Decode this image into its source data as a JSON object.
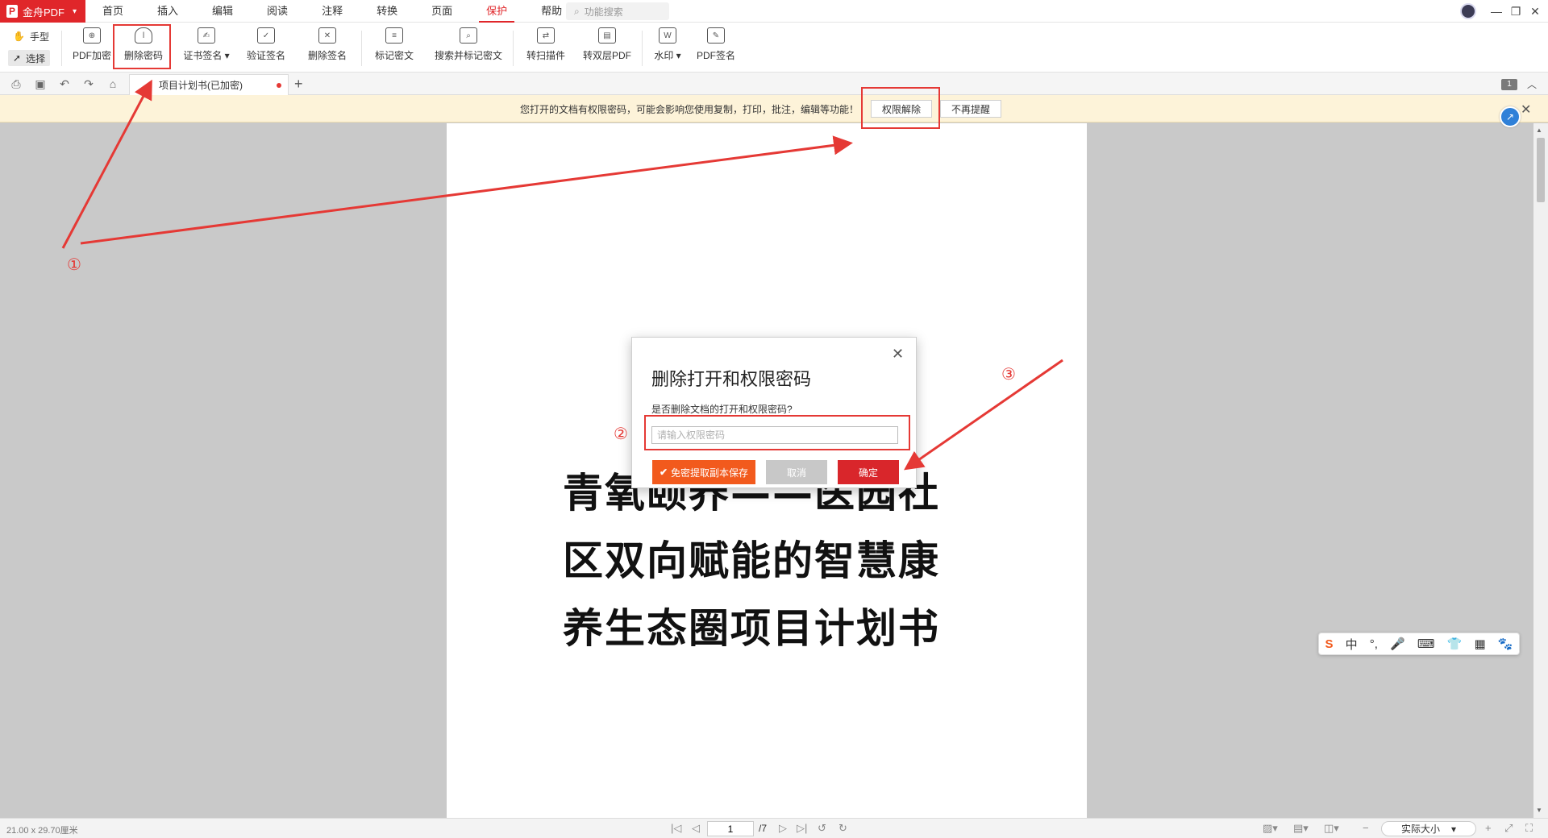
{
  "app": {
    "name": "金舟PDF",
    "logo_glyph": "P",
    "brand_color": "#e0262a"
  },
  "menu": {
    "items": [
      "首页",
      "插入",
      "编辑",
      "阅读",
      "注释",
      "转换",
      "页面",
      "保护",
      "帮助"
    ],
    "active": "保护",
    "search_placeholder": "功能搜索"
  },
  "mode_tools": {
    "hand": "手型",
    "select": "选择"
  },
  "toolbar": {
    "pdf_encrypt": "PDF加密",
    "remove_password": "删除密码",
    "cert_sign": "证书签名",
    "verify_sign": "验证签名",
    "remove_sign": "删除签名",
    "mark_redact": "标记密文",
    "search_redact": "搜索并标记密文",
    "scan_plugin": "转扫描件",
    "to_dual_layer": "转双层PDF",
    "watermark": "水印",
    "pdf_sign": "PDF签名"
  },
  "tab": {
    "title": "项目计划书(已加密)"
  },
  "page_badge": "1",
  "notice": {
    "text": "您打开的文档有权限密码，可能会影响您使用复制，打印，批注，编辑等功能！",
    "unlock_button": "权限解除",
    "dismiss_button": "不再提醒"
  },
  "document": {
    "title_lines": [
      "青氧颐养——医园社",
      "区双向赋能的智慧康",
      "养生态圈项目计划书"
    ]
  },
  "dialog": {
    "title": "删除打开和权限密码",
    "question": "是否删除文档的打开和权限密码?",
    "input_placeholder": "请输入权限密码",
    "input_value": "",
    "free_extract_button": "免密提取副本保存",
    "cancel_button": "取消",
    "confirm_button": "确定"
  },
  "annotations": {
    "step1": "①",
    "step2": "②",
    "step3": "③",
    "color": "#e53935"
  },
  "ime": {
    "items": [
      "S",
      "中",
      "°,",
      "🎤",
      "⌨",
      "👕",
      "▦",
      "🐾"
    ]
  },
  "status": {
    "page_size": "21.00 x 29.70厘米",
    "current_page": "1",
    "total_pages": "/7",
    "zoom": "实际大小"
  }
}
